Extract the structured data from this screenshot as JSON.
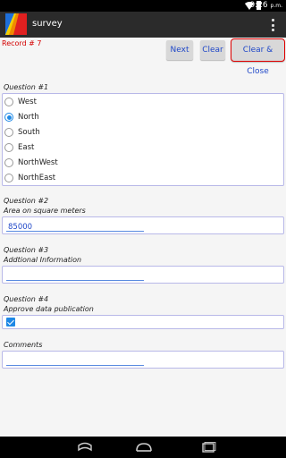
{
  "status_bar": {
    "time": "9:26",
    "time_suffix": "p.m."
  },
  "app": {
    "title": "survey"
  },
  "record": {
    "label": "Record # 7"
  },
  "toolbar": {
    "next_label": "Next",
    "clear_label": "Clear",
    "clear_close_label": "Clear & Close"
  },
  "questions": [
    {
      "number_label": "Question #1",
      "options": [
        "West",
        "North",
        "South",
        "East",
        "NorthWest",
        "NorthEast"
      ],
      "selected": "North"
    },
    {
      "number_label": "Question #2",
      "prompt": "Area on square meters",
      "value": "85000"
    },
    {
      "number_label": "Question #3",
      "prompt": "Addtional Information",
      "value": ""
    },
    {
      "number_label": "Question #4",
      "prompt": "Approve data publication",
      "checked": true
    }
  ],
  "comments": {
    "label": "Comments",
    "value": ""
  },
  "colors": {
    "accent": "#1e88e5",
    "button_text": "#2048c8",
    "record_label": "#d40000",
    "action_bar": "#2b2b2b"
  },
  "icons": [
    "app-logo-icon",
    "wifi-icon",
    "battery-icon",
    "overflow-menu-icon",
    "back-icon",
    "home-icon",
    "recents-icon"
  ]
}
